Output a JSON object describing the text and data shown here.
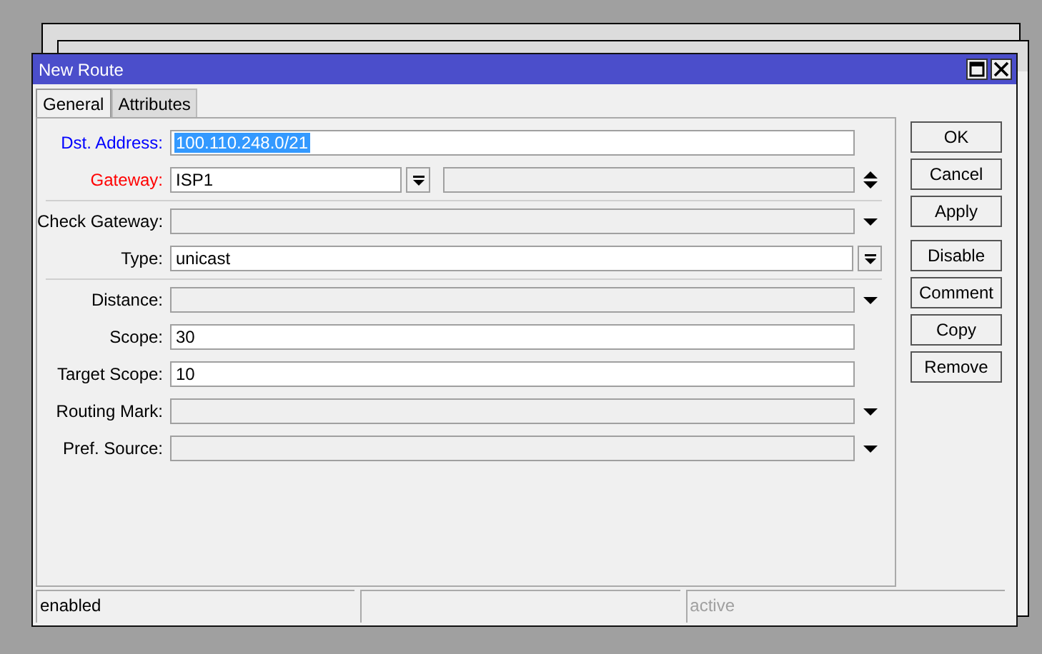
{
  "window": {
    "title": "New Route"
  },
  "tabs": [
    {
      "label": "General",
      "selected": true
    },
    {
      "label": "Attributes",
      "selected": false
    }
  ],
  "groups": [
    [
      {
        "label": "Dst. Address:",
        "color": "#0000ff",
        "kind": "text",
        "value": "100.110.248.0/21",
        "highlighted": true
      },
      {
        "label": "Gateway:",
        "color": "#ff0000",
        "kind": "gateway",
        "value": "ISP1"
      }
    ],
    [
      {
        "label": "Check Gateway:",
        "color": "#000000",
        "kind": "dropdown"
      },
      {
        "label": "Type:",
        "color": "#000000",
        "kind": "select",
        "value": "unicast"
      }
    ],
    [
      {
        "label": "Distance:",
        "color": "#000000",
        "kind": "dropdown"
      },
      {
        "label": "Scope:",
        "color": "#000000",
        "kind": "text",
        "value": "30"
      },
      {
        "label": "Target Scope:",
        "color": "#000000",
        "kind": "text",
        "value": "10"
      },
      {
        "label": "Routing Mark:",
        "color": "#000000",
        "kind": "dropdown"
      },
      {
        "label": "Pref. Source:",
        "color": "#000000",
        "kind": "dropdown"
      }
    ]
  ],
  "button_groups": [
    [
      "OK",
      "Cancel",
      "Apply"
    ],
    [
      "Disable",
      "Comment",
      "Copy",
      "Remove"
    ]
  ],
  "status_bar": {
    "cell_1": {
      "text": "enabled",
      "dimmed": false
    },
    "cell_3": {
      "text": "active",
      "dimmed": true
    }
  }
}
